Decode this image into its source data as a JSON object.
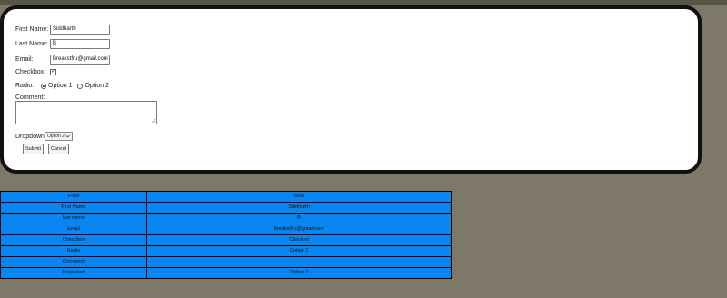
{
  "form": {
    "first_name_label": "First Name:",
    "first_name_value": "Siddharth",
    "last_name_label": "Last Name:",
    "last_name_value": "B",
    "email_label": "Email:",
    "email_value": "Breakstfru@gmail.com",
    "checkbox_label": "Checkbox:",
    "checkbox_mark": "✓",
    "radio_label": "Radio:",
    "radio_option1": "Option 1",
    "radio_option2": "Option 2",
    "comment_label": "Comment:",
    "dropdown_label": "Dropdown:",
    "dropdown_value": "Option 2",
    "submit_label": "Submit",
    "cancel_label": "Cancel"
  },
  "table": {
    "header": {
      "field": "Field",
      "value": "value"
    },
    "rows": [
      {
        "field": "First Name",
        "value": "Siddharth"
      },
      {
        "field": "last name",
        "value": "B"
      },
      {
        "field": "Email",
        "value": "Breakstfru@gmail.com"
      },
      {
        "field": "Checkbox",
        "value": "Checked"
      },
      {
        "field": "Radio",
        "value": "Option 1"
      },
      {
        "field": "Comment",
        "value": ""
      },
      {
        "field": "Dropdown",
        "value": "Option 2"
      }
    ]
  },
  "colors": {
    "background": "#7d7868",
    "table_cell": "#0a86f2",
    "card": "#ffffff"
  }
}
